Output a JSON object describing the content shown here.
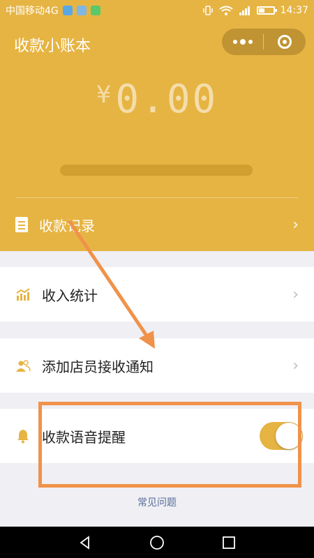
{
  "status_bar": {
    "carrier": "中国移动4G",
    "network": "4G",
    "time": "14:37"
  },
  "header": {
    "title": "收款小账本",
    "currency_symbol": "¥",
    "amount": "0.00",
    "record_label": "收款记录"
  },
  "menu": {
    "income_label": "收入统计",
    "staff_label": "添加店员接收通知",
    "voice_label": "收款语音提醒",
    "voice_enabled": true
  },
  "footer": {
    "faq_label": "常见问题"
  },
  "colors": {
    "primary": "#e6b443",
    "annotation": "#f0924a",
    "link": "#5a6e9a"
  },
  "icons": {
    "record": "document-icon",
    "income": "bar-chart-icon",
    "staff": "people-icon",
    "voice": "bell-icon"
  }
}
